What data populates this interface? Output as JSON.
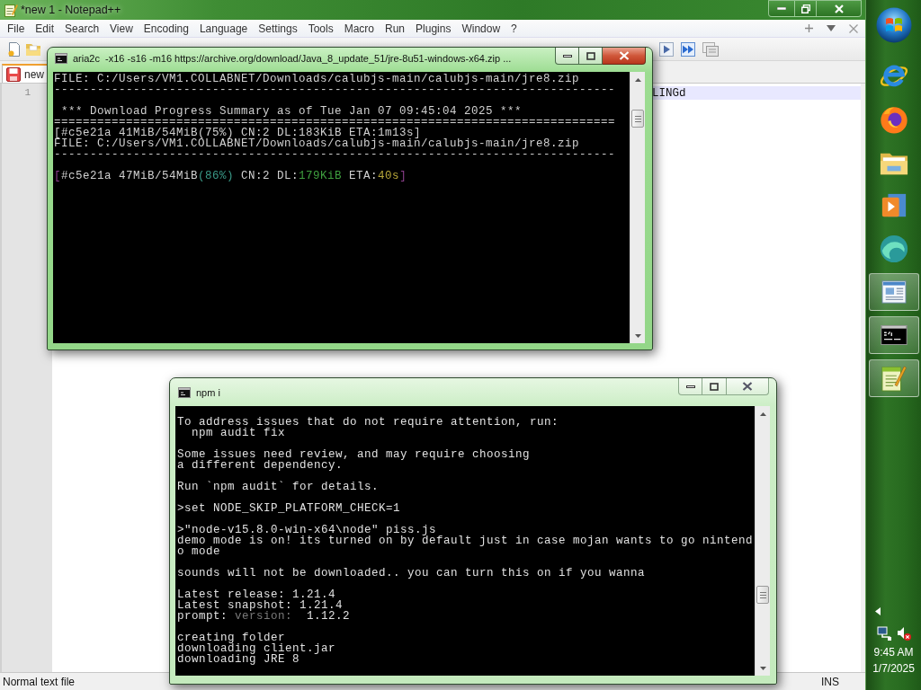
{
  "notepad": {
    "title": "*new 1 - Notepad++",
    "menu": [
      "File",
      "Edit",
      "Search",
      "View",
      "Encoding",
      "Language",
      "Settings",
      "Tools",
      "Macro",
      "Run",
      "Plugins",
      "Window",
      "?"
    ],
    "tabs": [
      {
        "label": "new",
        "selected": true
      }
    ],
    "editor": {
      "line_numbers": [
        "1"
      ],
      "visible_text": "LINGd"
    },
    "status_bar": {
      "file_type": "Normal text file",
      "mode": "INS"
    }
  },
  "windows": [
    {
      "title": "aria2c  -x16 -s16 -m16 https://archive.org/download/Java_8_update_51/jre-8u51-windows-x64.zip ...",
      "active": true,
      "console": [
        [
          "FILE: C:/Users/VM1.COLLABNET/Downloads/calubjs-main/calubjs-main/jre8.zip",
          "------------------------------------------------------------------------------"
        ],
        [
          " *** Download Progress Summary as of Tue Jan 07 09:45:04 2025 ***",
          "==============================================================================",
          "[#c5e21a 41MiB/54MiB(75%) CN:2 DL:183KiB ETA:1m13s]",
          "FILE: C:/Users/VM1.COLLABNET/Downloads/calubjs-main/calubjs-main/jre8.zip",
          "------------------------------------------------------------------------------"
        ],
        [
          {
            "segments": [
              {
                "text": "[",
                "color": "#8c3f8c"
              },
              {
                "text": "#c5e21a 47MiB/54MiB",
                "color": "#d0d0d0"
              },
              {
                "text": "(86%)",
                "color": "#3a9a88"
              },
              {
                "text": " CN:2 DL:",
                "color": "#d0d0d0"
              },
              {
                "text": "179KiB",
                "color": "#3f9f3f"
              },
              {
                "text": " ETA:",
                "color": "#d0d0d0"
              },
              {
                "text": "40s",
                "color": "#b8a83a"
              },
              {
                "text": "]",
                "color": "#8c3f8c"
              }
            ]
          }
        ]
      ]
    },
    {
      "title": "npm i",
      "active": false,
      "console": [
        [
          "To address issues that do not require attention, run:",
          "  npm audit fix"
        ],
        [
          "Some issues need review, and may require choosing",
          "a different dependency."
        ],
        [
          "Run `npm audit` for details."
        ],
        [
          ">set NODE_SKIP_PLATFORM_CHECK=1"
        ],
        [
          ">\"node-v15.8.0-win-x64\\node\" piss.js",
          "demo mode is on! its turned on by default just in case mojan wants to go nintend",
          "o mode"
        ],
        [
          "sounds will not be downloaded.. you can turn this on if you wanna"
        ],
        [
          "Latest release: 1.21.4",
          "Latest snapshot: 1.21.4",
          {
            "segments": [
              {
                "text": "prompt: ",
                "color": "#e0e0e0"
              },
              {
                "text": "version:",
                "color": "#7a7a7a"
              },
              {
                "text": "  1.12.2",
                "color": "#e0e0e0"
              }
            ]
          }
        ],
        [
          "creating folder",
          "downloading client.jar",
          "downloading JRE 8"
        ]
      ]
    }
  ],
  "taskbar": {
    "items": [
      {
        "kind": "e-browser",
        "running": false
      },
      {
        "kind": "fox-browser",
        "running": false
      },
      {
        "kind": "folder",
        "running": false
      },
      {
        "kind": "media",
        "running": false
      },
      {
        "kind": "swirl",
        "running": false
      },
      {
        "kind": "window",
        "running": true
      },
      {
        "kind": "console",
        "running": true
      },
      {
        "kind": "editor",
        "running": true
      }
    ],
    "clock": {
      "time": "9:45 AM",
      "date": "1/7/2025"
    }
  }
}
